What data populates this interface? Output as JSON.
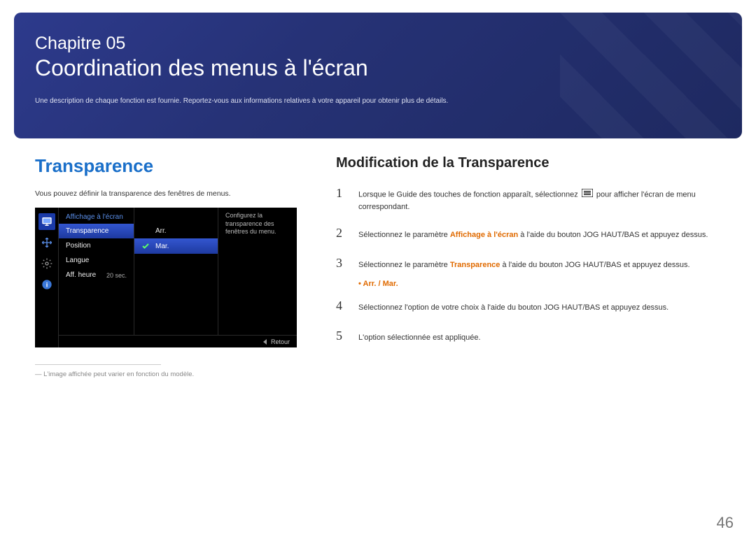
{
  "banner": {
    "chapter": "Chapitre 05",
    "title": "Coordination des menus à l'écran",
    "desc": "Une description de chaque fonction est fournie. Reportez-vous aux informations relatives à votre appareil pour obtenir plus de détails."
  },
  "left": {
    "heading": "Transparence",
    "intro": "Vous pouvez définir la transparence des fenêtres de menus."
  },
  "osd": {
    "title": "Affichage à l'écran",
    "items": [
      {
        "label": "Transparence",
        "value": "Arr."
      },
      {
        "label": "Position",
        "value": "Mar."
      },
      {
        "label": "Langue",
        "value": ""
      },
      {
        "label": "Aff. heure",
        "value": "20 sec."
      }
    ],
    "value_col": [
      {
        "label": "Arr.",
        "checked": false
      },
      {
        "label": "Mar.",
        "checked": true
      }
    ],
    "desc": "Configurez la transparence des fenêtres du menu.",
    "footer": "Retour"
  },
  "footnote": "― L'image affichée peut varier en fonction du modèle.",
  "right": {
    "heading": "Modification de la Transparence",
    "steps": {
      "s1_a": "Lorsque le Guide des touches de fonction apparaît, sélectionnez ",
      "s1_b": " pour afficher l'écran de menu correspondant.",
      "s2_a": "Sélectionnez le paramètre ",
      "s2_b": "Affichage à l'écran",
      "s2_c": " à l'aide du bouton JOG HAUT/BAS et appuyez dessus.",
      "s3_a": "Sélectionnez le paramètre ",
      "s3_b": "Transparence",
      "s3_c": " à l'aide du bouton JOG HAUT/BAS et appuyez dessus.",
      "bullet": "•   Arr. / Mar.",
      "s4": "Sélectionnez l'option de votre choix à l'aide du bouton JOG HAUT/BAS et appuyez dessus.",
      "s5": "L'option sélectionnée est appliquée."
    }
  },
  "page_number": "46"
}
